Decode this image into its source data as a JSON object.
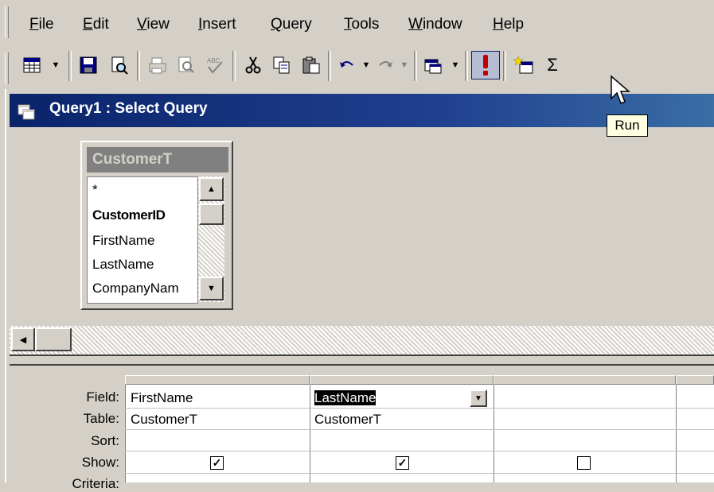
{
  "menu": {
    "items": [
      {
        "label": "File",
        "u": "F",
        "rest": "ile"
      },
      {
        "label": "Edit",
        "u": "E",
        "rest": "dit"
      },
      {
        "label": "View",
        "u": "V",
        "rest": "iew"
      },
      {
        "label": "Insert",
        "u": "I",
        "rest": "nsert"
      },
      {
        "label": "Query",
        "u": "Q",
        "rest": "uery"
      },
      {
        "label": "Tools",
        "u": "T",
        "rest": "ools"
      },
      {
        "label": "Window",
        "u": "W",
        "rest": "indow"
      },
      {
        "label": "Help",
        "u": "H",
        "rest": "elp"
      }
    ]
  },
  "toolbar": {
    "run_tooltip": "Run",
    "sigma": "Σ"
  },
  "window": {
    "title": "Query1 : Select Query"
  },
  "table": {
    "name": "CustomerT",
    "fields": [
      "*",
      "CustomerID",
      "FirstName",
      "LastName",
      "CompanyNam"
    ],
    "key_field": "CustomerID"
  },
  "grid": {
    "row_labels": [
      "Field:",
      "Table:",
      "Sort:",
      "Show:",
      "Criteria:"
    ],
    "columns": [
      {
        "field": "FirstName",
        "table": "CustomerT",
        "sort": "",
        "show": true
      },
      {
        "field": "LastName",
        "table": "CustomerT",
        "sort": "",
        "show": true
      },
      {
        "field": "",
        "table": "",
        "sort": "",
        "show": false
      }
    ]
  },
  "colors": {
    "title_bar": "#0a246a",
    "face": "#d4d0c8",
    "run_icon": "#c00000"
  }
}
